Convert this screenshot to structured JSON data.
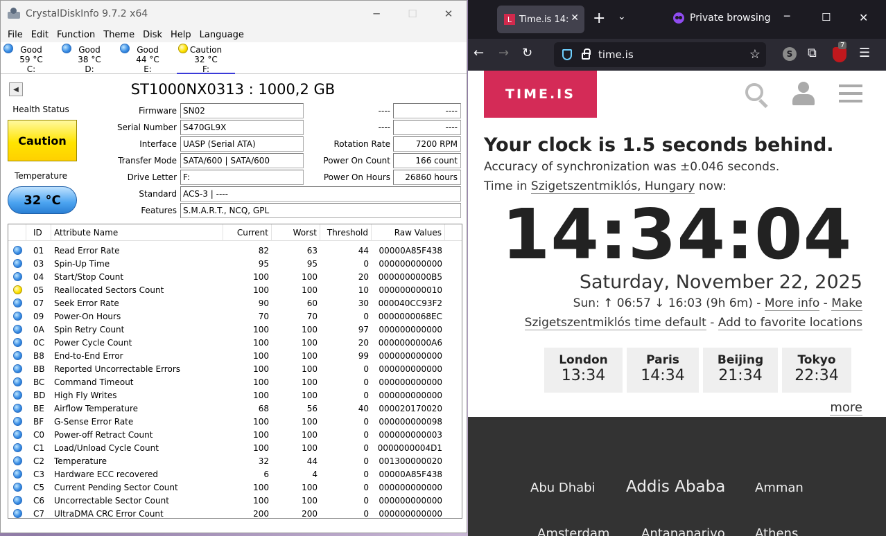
{
  "cdi": {
    "title": "CrystalDiskInfo 9.7.2 x64",
    "menu": [
      "File",
      "Edit",
      "Function",
      "Theme",
      "Disk",
      "Help",
      "Language"
    ],
    "disks": [
      {
        "status": "Good",
        "temp": "59 °C",
        "letter": "C:"
      },
      {
        "status": "Good",
        "temp": "38 °C",
        "letter": "D:"
      },
      {
        "status": "Good",
        "temp": "44 °C",
        "letter": "E:"
      },
      {
        "status": "Caution",
        "temp": "32 °C",
        "letter": "F:"
      }
    ],
    "model": "ST1000NX0313 : 1000,2 GB",
    "health_label": "Health Status",
    "health_value": "Caution",
    "temp_label": "Temperature",
    "temp_value": "32 °C",
    "labels": {
      "firmware": "Firmware",
      "serial": "Serial Number",
      "interface": "Interface",
      "transfer": "Transfer Mode",
      "letter": "Drive Letter",
      "standard": "Standard",
      "features": "Features",
      "rotation": "Rotation Rate",
      "power_count": "Power On Count",
      "power_hours": "Power On Hours",
      "blank1": "----",
      "blank2": "----"
    },
    "values": {
      "firmware": "SN02",
      "serial": "S470GL9X",
      "interface": "UASP (Serial ATA)",
      "transfer": "SATA/600 | SATA/600",
      "letter": "F:",
      "standard": "ACS-3 | ----",
      "features": "S.M.A.R.T., NCQ, GPL",
      "blank1": "----",
      "blank2": "----",
      "rotation": "7200 RPM",
      "power_count": "166 count",
      "power_hours": "26860 hours"
    },
    "columns": {
      "id": "ID",
      "name": "Attribute Name",
      "current": "Current",
      "worst": "Worst",
      "threshold": "Threshold",
      "raw": "Raw Values"
    },
    "attributes": [
      {
        "status": "good",
        "id": "01",
        "name": "Read Error Rate",
        "current": "82",
        "worst": "63",
        "threshold": "44",
        "raw": "00000A85F438"
      },
      {
        "status": "good",
        "id": "03",
        "name": "Spin-Up Time",
        "current": "95",
        "worst": "95",
        "threshold": "0",
        "raw": "000000000000"
      },
      {
        "status": "good",
        "id": "04",
        "name": "Start/Stop Count",
        "current": "100",
        "worst": "100",
        "threshold": "20",
        "raw": "0000000000B5"
      },
      {
        "status": "caution",
        "id": "05",
        "name": "Reallocated Sectors Count",
        "current": "100",
        "worst": "100",
        "threshold": "10",
        "raw": "000000000010"
      },
      {
        "status": "good",
        "id": "07",
        "name": "Seek Error Rate",
        "current": "90",
        "worst": "60",
        "threshold": "30",
        "raw": "000040CC93F2"
      },
      {
        "status": "good",
        "id": "09",
        "name": "Power-On Hours",
        "current": "70",
        "worst": "70",
        "threshold": "0",
        "raw": "0000000068EC"
      },
      {
        "status": "good",
        "id": "0A",
        "name": "Spin Retry Count",
        "current": "100",
        "worst": "100",
        "threshold": "97",
        "raw": "000000000000"
      },
      {
        "status": "good",
        "id": "0C",
        "name": "Power Cycle Count",
        "current": "100",
        "worst": "100",
        "threshold": "20",
        "raw": "0000000000A6"
      },
      {
        "status": "good",
        "id": "B8",
        "name": "End-to-End Error",
        "current": "100",
        "worst": "100",
        "threshold": "99",
        "raw": "000000000000"
      },
      {
        "status": "good",
        "id": "BB",
        "name": "Reported Uncorrectable Errors",
        "current": "100",
        "worst": "100",
        "threshold": "0",
        "raw": "000000000000"
      },
      {
        "status": "good",
        "id": "BC",
        "name": "Command Timeout",
        "current": "100",
        "worst": "100",
        "threshold": "0",
        "raw": "000000000000"
      },
      {
        "status": "good",
        "id": "BD",
        "name": "High Fly Writes",
        "current": "100",
        "worst": "100",
        "threshold": "0",
        "raw": "000000000000"
      },
      {
        "status": "good",
        "id": "BE",
        "name": "Airflow Temperature",
        "current": "68",
        "worst": "56",
        "threshold": "40",
        "raw": "000020170020"
      },
      {
        "status": "good",
        "id": "BF",
        "name": "G-Sense Error Rate",
        "current": "100",
        "worst": "100",
        "threshold": "0",
        "raw": "000000000098"
      },
      {
        "status": "good",
        "id": "C0",
        "name": "Power-off Retract Count",
        "current": "100",
        "worst": "100",
        "threshold": "0",
        "raw": "000000000003"
      },
      {
        "status": "good",
        "id": "C1",
        "name": "Load/Unload Cycle Count",
        "current": "100",
        "worst": "100",
        "threshold": "0",
        "raw": "0000000004D1"
      },
      {
        "status": "good",
        "id": "C2",
        "name": "Temperature",
        "current": "32",
        "worst": "44",
        "threshold": "0",
        "raw": "001300000020"
      },
      {
        "status": "good",
        "id": "C3",
        "name": "Hardware ECC recovered",
        "current": "6",
        "worst": "4",
        "threshold": "0",
        "raw": "00000A85F438"
      },
      {
        "status": "good",
        "id": "C5",
        "name": "Current Pending Sector Count",
        "current": "100",
        "worst": "100",
        "threshold": "0",
        "raw": "000000000000"
      },
      {
        "status": "good",
        "id": "C6",
        "name": "Uncorrectable Sector Count",
        "current": "100",
        "worst": "100",
        "threshold": "0",
        "raw": "000000000000"
      },
      {
        "status": "good",
        "id": "C7",
        "name": "UltraDMA CRC Error Count",
        "current": "200",
        "worst": "200",
        "threshold": "0",
        "raw": "000000000000"
      }
    ]
  },
  "firefox": {
    "tab_title": "Time.is 14:",
    "tab_favicon": "L",
    "private_label": "Private browsing",
    "url": "time.is",
    "badge_count": "7",
    "extension_letter": "S",
    "site": {
      "logo": "TIME.IS",
      "behind": "Your clock is 1.5 seconds behind.",
      "accuracy": "Accuracy of synchronization was ±0.046 seconds.",
      "timein_prefix": "Time in ",
      "location": "Szigetszentmiklós, Hungary",
      "timein_suffix": " now:",
      "clock": "14:34:04",
      "date": "Saturday, November 22, 2025",
      "sun_text": "Sun: ↑ 06:57 ↓ 16:03 (9h 6m) - ",
      "more_info": "More info",
      "sep": " - ",
      "make": "Make",
      "default_link": "Szigetszentmiklós time default",
      "add_fav": "Add to favorite locations",
      "fav_clocks": [
        {
          "city": "London",
          "time": "13:34"
        },
        {
          "city": "Paris",
          "time": "14:34"
        },
        {
          "city": "Beijing",
          "time": "21:34"
        },
        {
          "city": "Tokyo",
          "time": "22:34"
        }
      ],
      "more": "more",
      "cities": [
        "Abu Dhabi",
        "Addis Ababa",
        "Amman",
        "Amsterdam",
        "Antananarivo",
        "Athens"
      ]
    }
  },
  "colors": {
    "time_is_red": "#d42b57",
    "firefox_dark": "#1c1b22",
    "caution_yellow": "#ffe400",
    "good_blue": "#3b8fe6"
  }
}
